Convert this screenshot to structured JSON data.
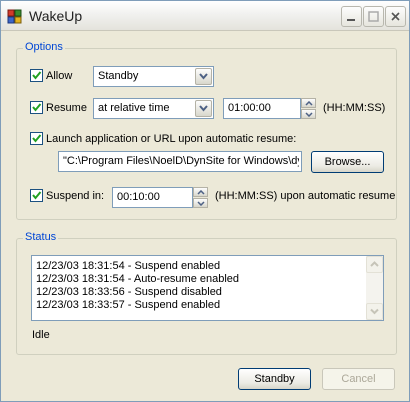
{
  "window": {
    "title": "WakeUp"
  },
  "options": {
    "legend": "Options",
    "allow_label": "Allow",
    "allow_value": "Standby",
    "resume_label": "Resume",
    "resume_mode": "at relative time",
    "resume_time": "01:00:00",
    "resume_format": "(HH:MM:SS)",
    "launch_label": "Launch application or URL upon automatic resume:",
    "launch_path": "\"C:\\Program Files\\NoelD\\DynSite for Windows\\dy",
    "browse_label": "Browse...",
    "suspend_label": "Suspend in:",
    "suspend_time": "00:10:00",
    "suspend_note": "(HH:MM:SS) upon automatic resume"
  },
  "status": {
    "legend": "Status",
    "log": [
      "12/23/03 18:31:54 - Suspend enabled",
      "12/23/03 18:31:54 - Auto-resume enabled",
      "12/23/03 18:33:56 - Suspend disabled",
      "12/23/03 18:33:57 - Suspend enabled"
    ],
    "state": "Idle"
  },
  "buttons": {
    "standby": "Standby",
    "cancel": "Cancel"
  },
  "colors": {
    "legend": "#0046d5",
    "check": "#21a121",
    "face": "#ece9d8"
  }
}
